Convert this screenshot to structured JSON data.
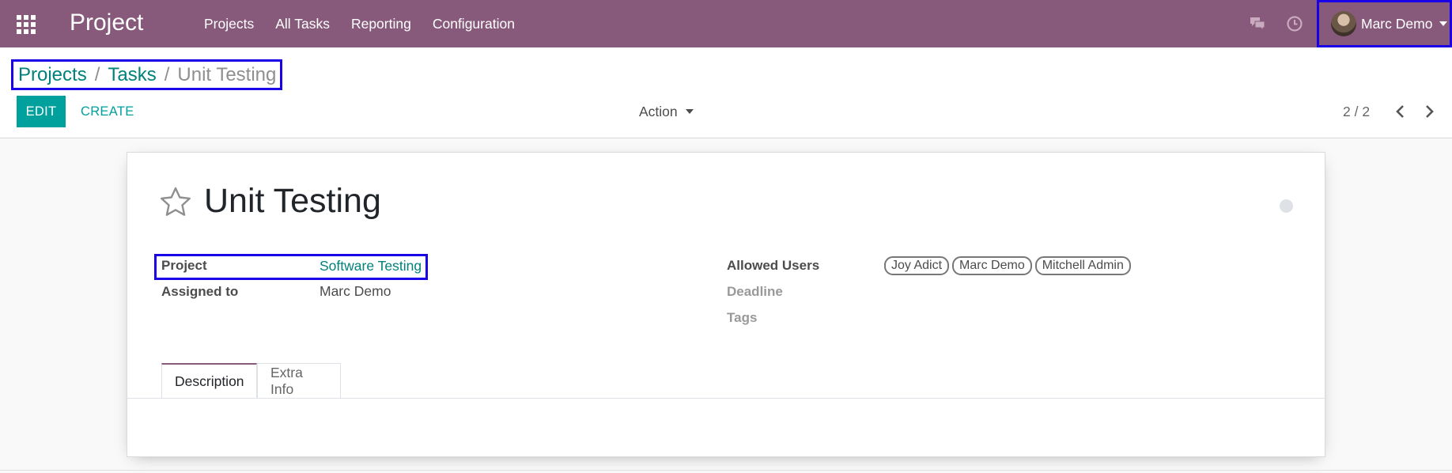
{
  "navbar": {
    "app_title": "Project",
    "menu": [
      "Projects",
      "All Tasks",
      "Reporting",
      "Configuration"
    ],
    "user_name": "Marc Demo",
    "bg_color": "#875a7b"
  },
  "breadcrumb": {
    "items": [
      "Projects",
      "Tasks"
    ],
    "separator": "/",
    "current": "Unit Testing"
  },
  "control_panel": {
    "edit_label": "EDIT",
    "create_label": "CREATE",
    "action_label": "Action",
    "pager_value": "2 / 2"
  },
  "task": {
    "title": "Unit Testing",
    "left_fields": [
      {
        "label": "Project",
        "value": "Software Testing"
      },
      {
        "label": "Assigned to",
        "value": "Marc Demo"
      }
    ],
    "right_fields": {
      "allowed_users_label": "Allowed Users",
      "allowed_users": [
        "Joy Adict",
        "Marc Demo",
        "Mitchell Admin"
      ],
      "deadline_label": "Deadline",
      "tags_label": "Tags"
    },
    "tabs": [
      "Description",
      "Extra Info"
    ]
  },
  "icons": {
    "apps": "apps-grid-icon",
    "chat": "chat-icon",
    "activity": "clock-icon",
    "favorite": "star-icon",
    "pager_prev": "chevron-left-icon",
    "pager_next": "chevron-right-icon"
  },
  "colors": {
    "accent": "#00a09d",
    "link": "#00827b",
    "highlight_box": "#1a00e6"
  }
}
